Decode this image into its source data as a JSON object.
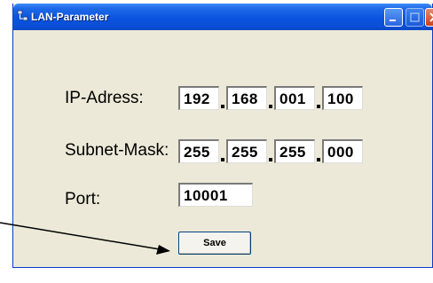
{
  "window": {
    "title": "LAN-Parameter"
  },
  "form": {
    "ip_label": "IP-Adress:",
    "ip_octets": [
      "192",
      "168",
      "001",
      "100"
    ],
    "subnet_label": "Subnet-Mask:",
    "subnet_octets": [
      "255",
      "255",
      "255",
      "000"
    ],
    "port_label": "Port:",
    "port_value": "10001",
    "save_label": "Save"
  },
  "colors": {
    "titlebar": "#0a54e0",
    "window_bg": "#ece9d8",
    "close_button": "#c8401c"
  }
}
